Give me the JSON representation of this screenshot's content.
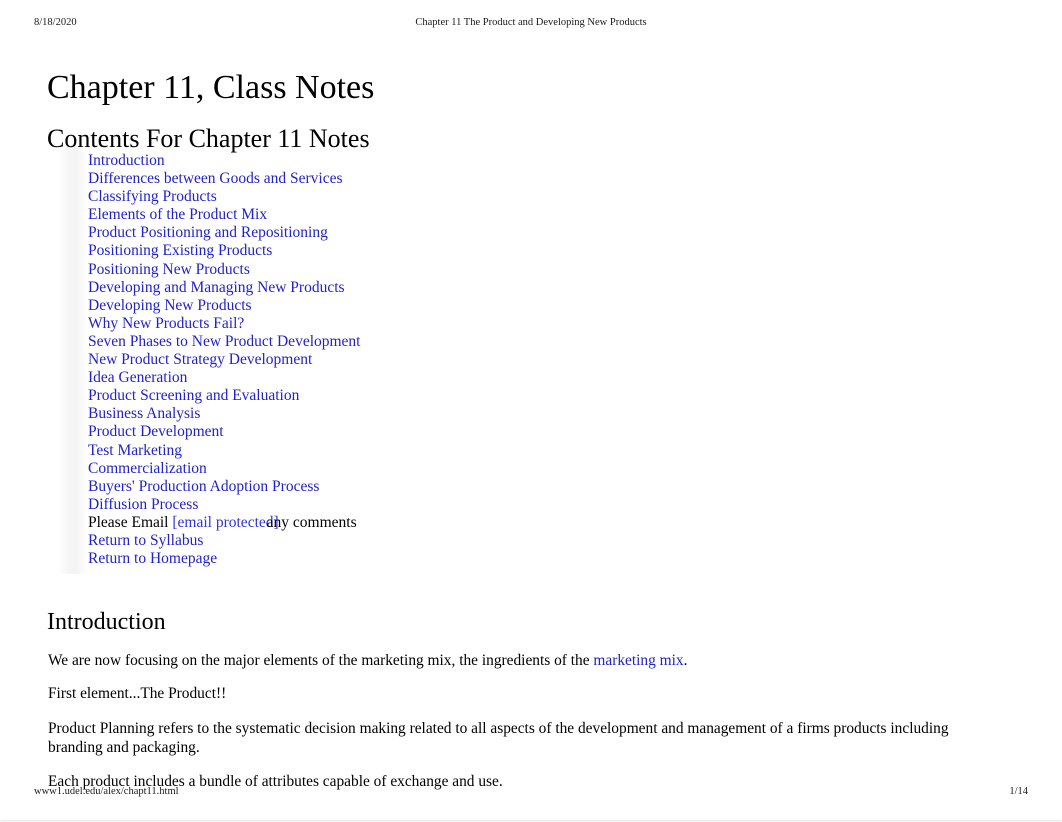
{
  "document": {
    "print_header": {
      "date": "8/18/2020",
      "title": "Chapter 11 The Product and Developing New Products"
    },
    "print_footer": {
      "url": "www1.udel.edu/alex/chapt11.html",
      "page": "1/14"
    },
    "title": "Chapter 11, Class Notes",
    "contents_heading": "Contents For Chapter 11 Notes",
    "toc": [
      {
        "label": "Introduction",
        "type": "link"
      },
      {
        "label": "Differences between Goods and Services",
        "type": "link"
      },
      {
        "label": "Classifying Products",
        "type": "link"
      },
      {
        "label": "Elements of the Product Mix",
        "type": "link"
      },
      {
        "label": "Product Positioning and Repositioning",
        "type": "link"
      },
      {
        "label": "Positioning Existing Products",
        "type": "link"
      },
      {
        "label": "Positioning New Products",
        "type": "link"
      },
      {
        "label": "Developing and Managing New Products",
        "type": "link"
      },
      {
        "label": "Developing New Products",
        "type": "link"
      },
      {
        "label": "Why New Products Fail?",
        "type": "link"
      },
      {
        "label": "Seven Phases to New Product Development",
        "type": "link"
      },
      {
        "label": "New Product Strategy Development",
        "type": "link"
      },
      {
        "label": "Idea Generation",
        "type": "link"
      },
      {
        "label": "Product Screening and Evaluation",
        "type": "link"
      },
      {
        "label": "Business Analysis",
        "type": "link"
      },
      {
        "label": "Product Development",
        "type": "link"
      },
      {
        "label": "Test Marketing",
        "type": "link"
      },
      {
        "label": "Commercialization",
        "type": "link"
      },
      {
        "label": "Buyers' Production Adoption Process",
        "type": "link"
      },
      {
        "label": "Diffusion Process",
        "type": "link"
      }
    ],
    "email_line": {
      "prefix": "Please Email ",
      "link": "[email protected]",
      "suffix": "any comments"
    },
    "toc_tail": [
      {
        "label": "Return to Syllabus",
        "type": "link"
      },
      {
        "label": "Return to Homepage",
        "type": "link"
      }
    ],
    "introduction": {
      "heading": "Introduction",
      "p1_before": "We are now focusing on the major elements of the marketing mix, the ingredients of the ",
      "p1_link": "marketing mix",
      "p1_after": ".",
      "p2": "First element...The Product!!",
      "p3": "Product Planning  refers to the systematic decision making related to all aspects of the development and management of a firms products including branding and packaging.",
      "p4": "Each product includes a bundle of attributes capable of exchange and use."
    },
    "colors": {
      "link": "#2222cc",
      "text": "#000000",
      "background": "#ffffff"
    }
  }
}
